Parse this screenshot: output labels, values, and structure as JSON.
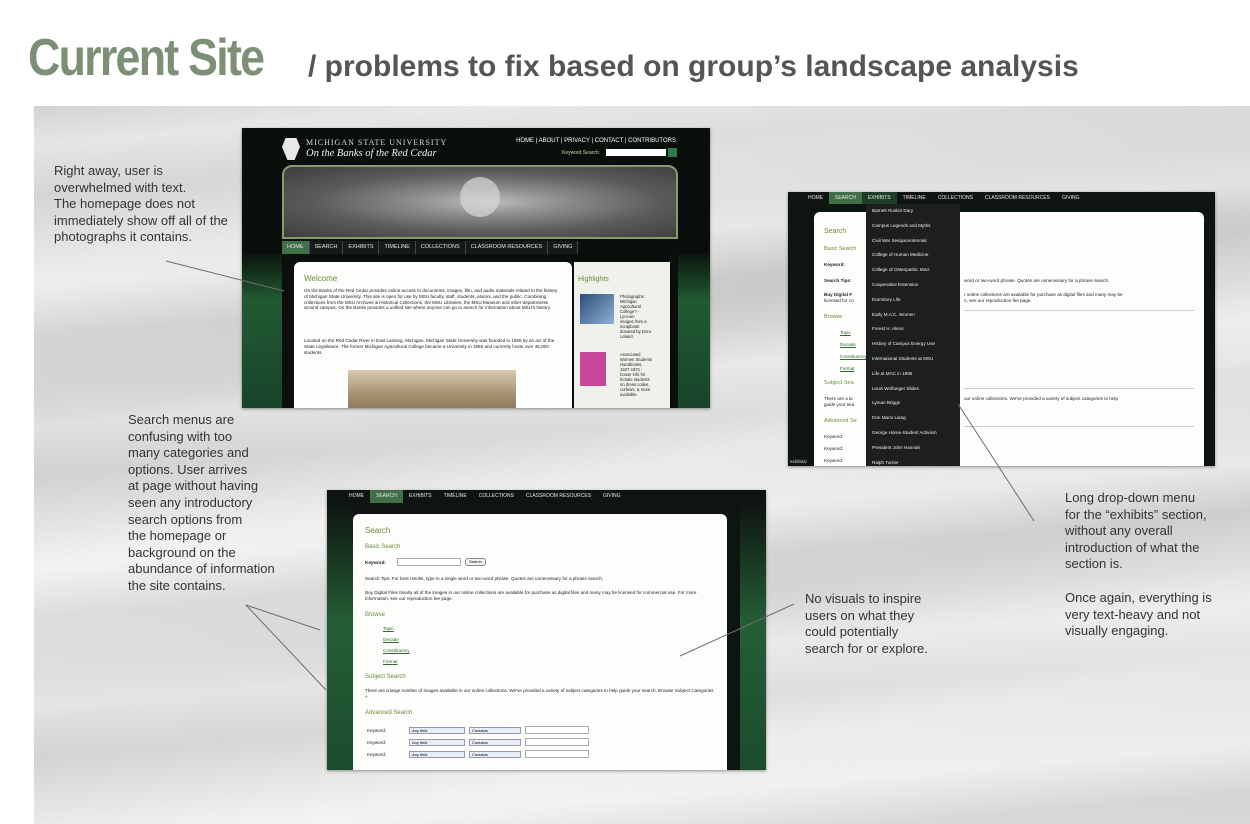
{
  "title": {
    "main": "Current Site",
    "sub": "/ problems to fix based on group’s landscape analysis"
  },
  "annotations": {
    "overwhelmed": "Right away, user is\noverwhelmed with text.\nThe homepage does not\nimmediately show off all of the\nphotographs it contains.",
    "search_menus": "Search menus are\nconfusing with too\nmany categories and\noptions. User arrives\nat page without having\nseen any introductory\nsearch options from\nthe homepage or\nbackground on the\nabundance of information\nthe site contains.",
    "no_visuals": "No visuals to inspire\nusers on what they\ncould potentially\nsearch for or explore.",
    "dropdown": "Long drop-down menu\nfor the “exhibits” section,\nwithout any overall\nintroduction of what the\nsection is.",
    "text_heavy": "Once again, everything is\nvery text-heavy and not\nvisually engaging."
  },
  "home_screenshot": {
    "university": "MICHIGAN STATE UNIVERSITY",
    "site_name": "On the Banks of the Red Cedar",
    "top_links": "HOME | ABOUT | PRIVACY | CONTACT | CONTRIBUTORS",
    "search_label": "Keyword Search:",
    "nav": [
      "HOME",
      "SEARCH",
      "EXHIBITS",
      "TIMELINE",
      "COLLECTIONS",
      "CLASSROOM RESOURCES",
      "GIVING"
    ],
    "welcome_heading": "Welcome",
    "welcome_text": "On the Banks of the Red Cedar provides online access to documents, images, film, and audio materials related to the history of Michigan State University. This site is open for use by MSU faculty, staff, students, alumni, and the public. Combining collections from the MSU Archives & Historical Collections, the MSU Libraries, the MSU Museum and other departments around campus, On the Banks provides a unified site where anyone can go to search for information about MSU's history.",
    "location_text": "Located on the Red Cedar River in East Lansing, Michigan, Michigan State University was founded in 1855 by an act of the State Legislature. The former Michigan Agricultural College became a University in 1955 and currently hosts over 45,000 students.",
    "highlights_heading": "Highlights",
    "highlight_1": "Photographs:\nMichigan\nAgricultural\nCollege? -\nLyceum\nimages from a\nscrapbook\ndonated by Dora\nLeland.",
    "highlight_2": "Associated\nWomen Students\nHandbooks,\n1937-1971 -\nhouse info for\nfemale students\non dress codes,\ncurfews, & more\navailable."
  },
  "exhibits_screenshot": {
    "nav": [
      "HOME",
      "SEARCH",
      "EXHIBITS",
      "TIMELINE",
      "COLLECTIONS",
      "CLASSROOM RESOURCES",
      "GIVING"
    ],
    "dropdown_items": [
      "Barnett Ruskin Dary",
      "Campus Legends and Myths",
      "Civil War Sesquicentennial",
      "College of Human Medicine",
      "College of Osteopathic Med.",
      "Cooperative Extension",
      "Dormitory Life",
      "Early M.A.C. Women",
      "Forest H. Akers",
      "History of Campus Energy Use",
      "International Students at MSU",
      "Life at MAC in 1895",
      "Louis Wolfanger Slides",
      "Lyman Briggs",
      "Don Mann Liang",
      "George Horne-Student Activism",
      "President John Hannah",
      "Ralph Turner"
    ],
    "search_heading": "Search",
    "basic_search": "Basic Search",
    "keyword_label": "Keyword:",
    "search_tips": "Search Tips:",
    "search_tips_tail": "word or two-word phrase. Quotes are unnecessary for a phrase search.",
    "buy_files": "Buy Digital F",
    "buy_files_tail": "r online collections are available for purchase as digital files and many may be",
    "licensed": "licensed for co",
    "licensed_tail": "n, see our reproduction fee page.",
    "browse": "Browse",
    "browse_items": [
      "Topic",
      "Decade",
      "Constituency",
      "Format"
    ],
    "subject_search": "Subject Sea",
    "subject_text": "There are a la",
    "subject_tail": "our online collections. We've provided a variety of subject categories to help",
    "subject_line2": "guide your sea",
    "advanced_search": "Advanced Se",
    "keyword_rows": [
      "Keyword:",
      "Keyword:",
      "Keyword:"
    ],
    "status_url": "exhibits/"
  },
  "search_screenshot": {
    "nav": [
      "HOME",
      "SEARCH",
      "EXHIBITS",
      "TIMELINE",
      "COLLECTIONS",
      "CLASSROOM RESOURCES",
      "GIVING"
    ],
    "search_heading": "Search",
    "basic_search": "Basic Search",
    "keyword_label": "Keyword:",
    "search_button": "Search",
    "tips": "Search Tips: For best results, type in a single word or two-word phrase. Quotes are unnecessary for a phrase search.",
    "buy": "Buy Digital Files Nearly all of the images in our online collections are available for purchase as digital files and many may be licensed for commercial use. For more information, see our reproduction fee page.",
    "browse": "Browse",
    "browse_items": [
      "Topic",
      "Decade",
      "Constituency",
      "Format"
    ],
    "subject_search": "Subject Search",
    "subject_text": "There are a large number of images available in our online collections. We've provided a variety of subject categories to help guide your search. Browse Subject Categories »",
    "advanced_search": "Advanced Search",
    "keyword_rows": [
      "Keyword:",
      "Keyword:",
      "Keyword:"
    ],
    "field_select": "Any field",
    "contains_select": "Contains"
  }
}
